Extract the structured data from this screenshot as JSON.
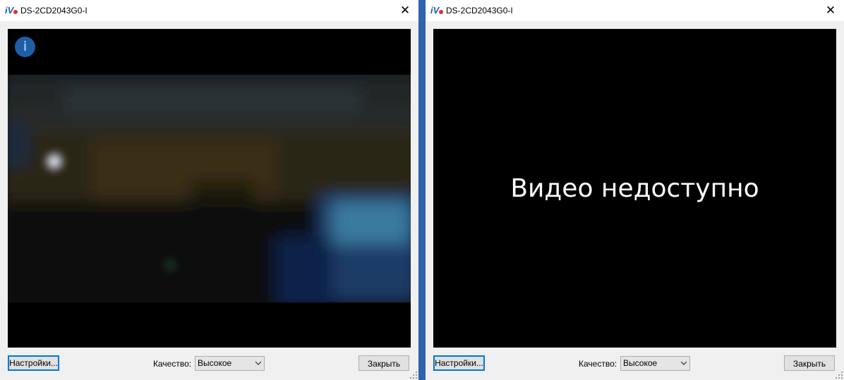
{
  "windows": [
    {
      "title": "DS-2CD2043G0-I",
      "video_state": "live",
      "info_icon_glyph": "i",
      "unavailable_text": "",
      "settings_label": "Настройки...",
      "quality_label": "Качество:",
      "quality_value": "Высокое",
      "close_label": "Закрыть",
      "close_glyph": "✕"
    },
    {
      "title": "DS-2CD2043G0-I",
      "video_state": "unavailable",
      "info_icon_glyph": "",
      "unavailable_text": "Видео недоступно",
      "settings_label": "Настройки...",
      "quality_label": "Качество:",
      "quality_value": "Высокое",
      "close_label": "Закрыть",
      "close_glyph": "✕"
    }
  ],
  "colors": {
    "accent": "#0078d7",
    "info_icon": "#1e5ea8",
    "desktop": "#2b5fa8"
  },
  "icons": [
    "app-logo-icon",
    "close-icon",
    "info-icon",
    "chevron-down-icon",
    "resize-grip-icon"
  ]
}
